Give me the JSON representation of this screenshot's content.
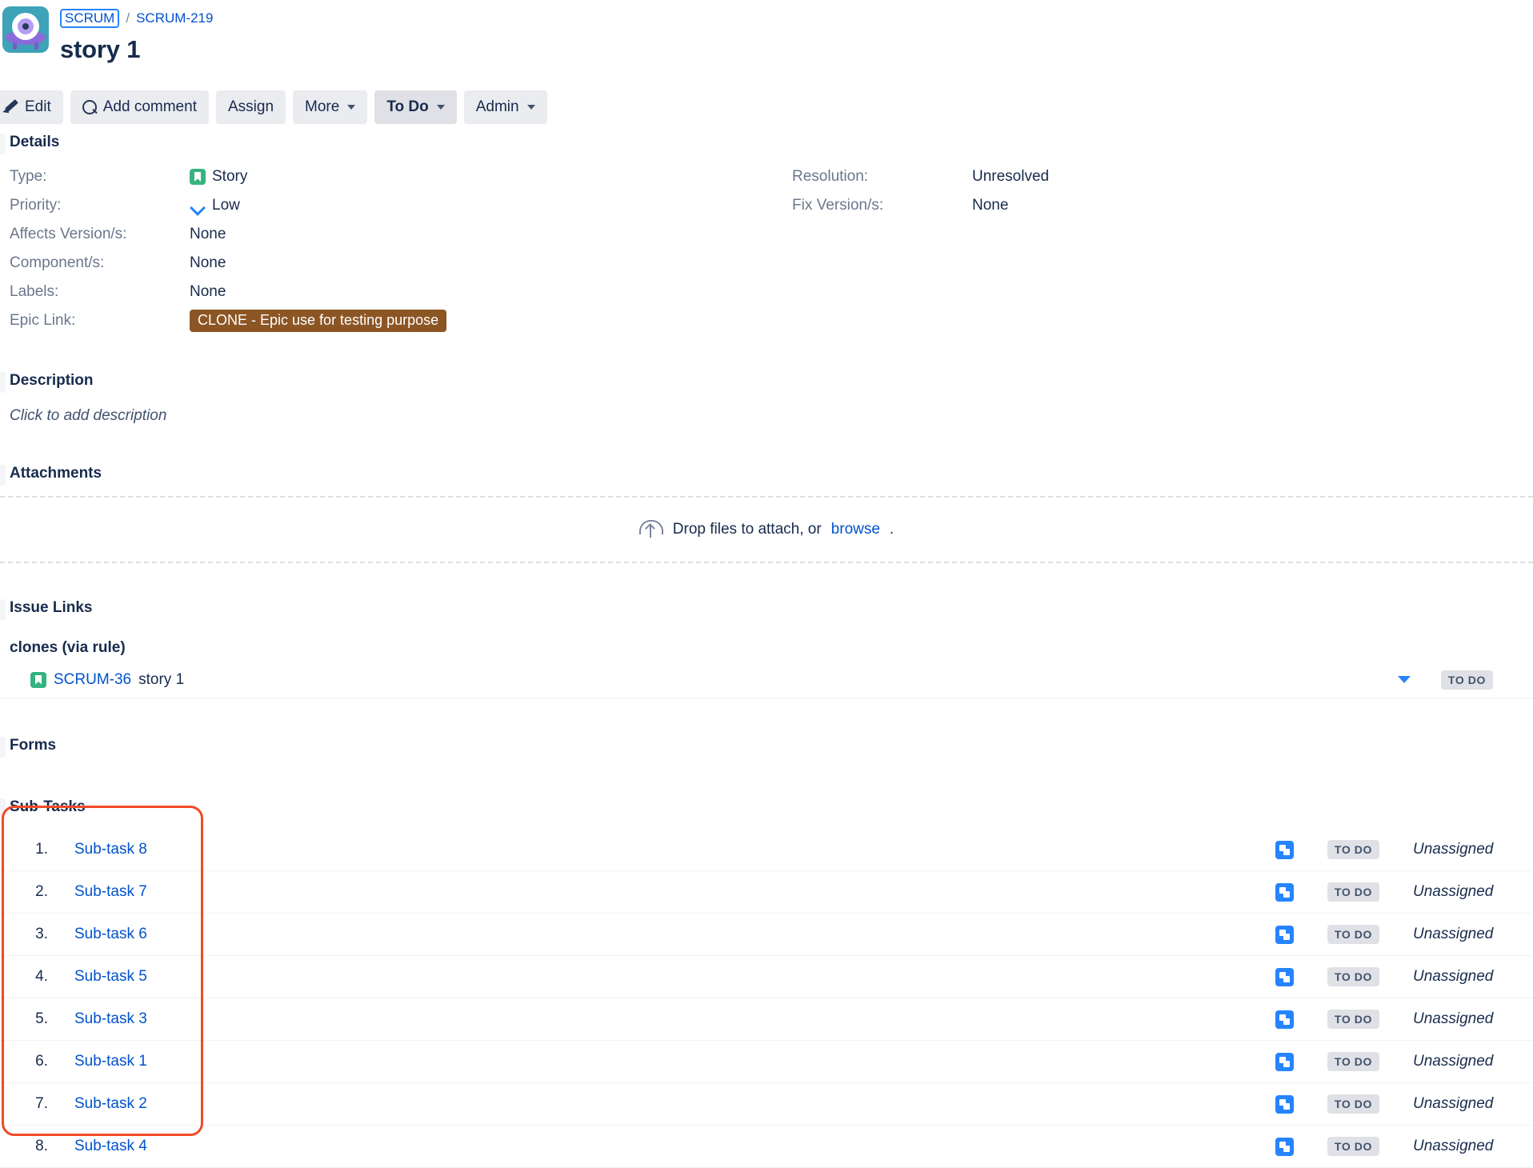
{
  "header": {
    "avatar_name": "project-avatar",
    "breadcrumb": {
      "project": "SCRUM",
      "separator": "/",
      "issue_key": "SCRUM-219"
    },
    "title": "story 1"
  },
  "toolbar": {
    "edit": "Edit",
    "add_comment": "Add comment",
    "assign": "Assign",
    "more": "More",
    "status": "To Do",
    "admin": "Admin"
  },
  "details": {
    "heading": "Details",
    "left": [
      {
        "label": "Type:",
        "value": "Story",
        "icon": "story-icon"
      },
      {
        "label": "Priority:",
        "value": "Low",
        "icon": "priority-low-icon"
      },
      {
        "label": "Affects Version/s:",
        "value": "None",
        "icon": ""
      },
      {
        "label": "Component/s:",
        "value": "None",
        "icon": ""
      },
      {
        "label": "Labels:",
        "value": "None",
        "icon": ""
      },
      {
        "label": "Epic Link:",
        "value": "CLONE - Epic use for testing purpose",
        "icon": "epic-badge"
      }
    ],
    "right": [
      {
        "label": "Resolution:",
        "value": "Unresolved"
      },
      {
        "label": "Fix Version/s:",
        "value": "None"
      }
    ]
  },
  "description": {
    "heading": "Description",
    "placeholder": "Click to add description"
  },
  "attachments": {
    "heading": "Attachments",
    "drop_text": "Drop files to attach, or",
    "browse_label": "browse",
    "period": "."
  },
  "issue_links": {
    "heading": "Issue Links",
    "group_label": "clones (via rule)",
    "rows": [
      {
        "key": "SCRUM-36",
        "summary": "story 1",
        "status": "TO DO"
      }
    ]
  },
  "forms": {
    "heading": "Forms"
  },
  "subtasks": {
    "heading": "Sub-Tasks",
    "rows": [
      {
        "num": "1.",
        "name": "Sub-task 8",
        "status": "TO DO",
        "assignee": "Unassigned"
      },
      {
        "num": "2.",
        "name": "Sub-task 7",
        "status": "TO DO",
        "assignee": "Unassigned"
      },
      {
        "num": "3.",
        "name": "Sub-task 6",
        "status": "TO DO",
        "assignee": "Unassigned"
      },
      {
        "num": "4.",
        "name": "Sub-task 5",
        "status": "TO DO",
        "assignee": "Unassigned"
      },
      {
        "num": "5.",
        "name": "Sub-task 3",
        "status": "TO DO",
        "assignee": "Unassigned"
      },
      {
        "num": "6.",
        "name": "Sub-task 1",
        "status": "TO DO",
        "assignee": "Unassigned"
      },
      {
        "num": "7.",
        "name": "Sub-task 2",
        "status": "TO DO",
        "assignee": "Unassigned"
      },
      {
        "num": "8.",
        "name": "Sub-task 4",
        "status": "TO DO",
        "assignee": "Unassigned"
      }
    ]
  },
  "colors": {
    "link": "#0052CC",
    "epic_badge": "#8C5524",
    "story_icon": "#36B37E",
    "subtask_icon": "#2684FF",
    "annotation": "#F04A25",
    "status_pill_bg": "#DFE1E6",
    "text": "#172B4D"
  }
}
